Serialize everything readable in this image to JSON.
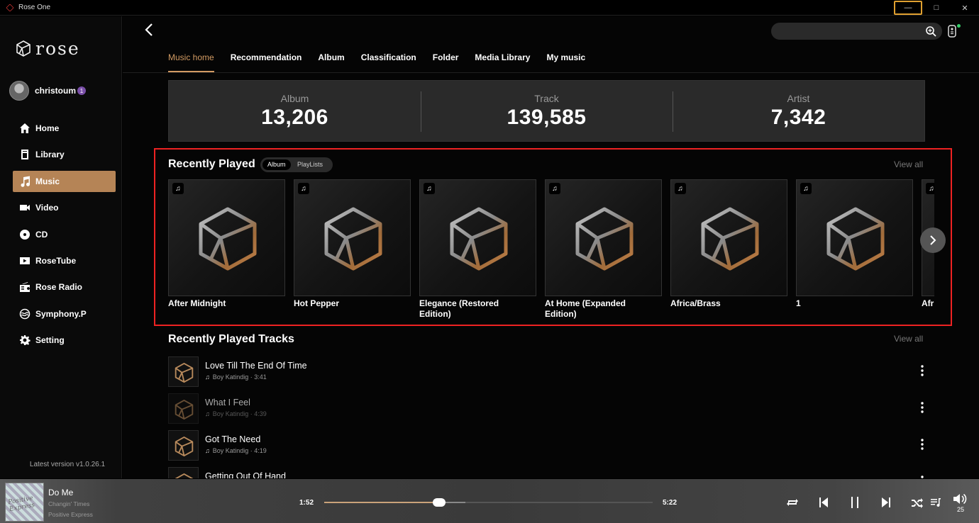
{
  "window": {
    "title": "Rose One",
    "controls": [
      "—",
      "□",
      "✕"
    ]
  },
  "sidebar": {
    "logo_text": "rose",
    "user": {
      "name": "christoum",
      "badge": "1"
    },
    "items": [
      {
        "label": "Home",
        "icon": "home-icon"
      },
      {
        "label": "Library",
        "icon": "library-icon"
      },
      {
        "label": "Music",
        "icon": "music-icon",
        "active": true
      },
      {
        "label": "Video",
        "icon": "video-icon"
      },
      {
        "label": "CD",
        "icon": "cd-icon"
      },
      {
        "label": "RoseTube",
        "icon": "rosetube-icon"
      },
      {
        "label": "Rose Radio",
        "icon": "radio-icon"
      },
      {
        "label": "Symphony.P",
        "icon": "symphony-icon"
      },
      {
        "label": "Setting",
        "icon": "gear-icon"
      }
    ],
    "version": "Latest version v1.0.26.1"
  },
  "header": {
    "search_placeholder": "",
    "tabs": [
      "Music home",
      "Recommendation",
      "Album",
      "Classification",
      "Folder",
      "Media Library",
      "My music"
    ],
    "active_tab": "Music home"
  },
  "stats": [
    {
      "label": "Album",
      "value": "13,206"
    },
    {
      "label": "Track",
      "value": "139,585"
    },
    {
      "label": "Artist",
      "value": "7,342"
    }
  ],
  "recently_played": {
    "title": "Recently Played",
    "chips": [
      "Album",
      "PlayLists"
    ],
    "view_all": "View all",
    "items": [
      {
        "title": "After Midnight"
      },
      {
        "title": "Hot Pepper"
      },
      {
        "title": "Elegance (Restored Edition)"
      },
      {
        "title": "At Home (Expanded Edition)"
      },
      {
        "title": "Africa/Brass"
      },
      {
        "title": "1"
      },
      {
        "title": "Afr"
      }
    ]
  },
  "recently_played_tracks": {
    "title": "Recently Played Tracks",
    "view_all": "View all",
    "items": [
      {
        "title": "Love Till The End Of Time",
        "meta": "Boy Katindig · 3:41"
      },
      {
        "title": "What I Feel",
        "meta": "Boy Katindig · 4:39"
      },
      {
        "title": "Got The Need",
        "meta": "Boy Katindig · 4:19"
      },
      {
        "title": "Getting Out Of Hand",
        "meta": ""
      }
    ]
  },
  "player": {
    "album_art_text": "Positive Express",
    "title": "Do Me",
    "album": "Changin' Times",
    "artist": "Positive Express",
    "elapsed": "1:52",
    "duration": "5:22",
    "progress": 0.35,
    "buffered": 0.43,
    "volume": "25"
  },
  "colors": {
    "accent": "#b58456",
    "highlight_border": "#e22222",
    "background": "#000000"
  }
}
